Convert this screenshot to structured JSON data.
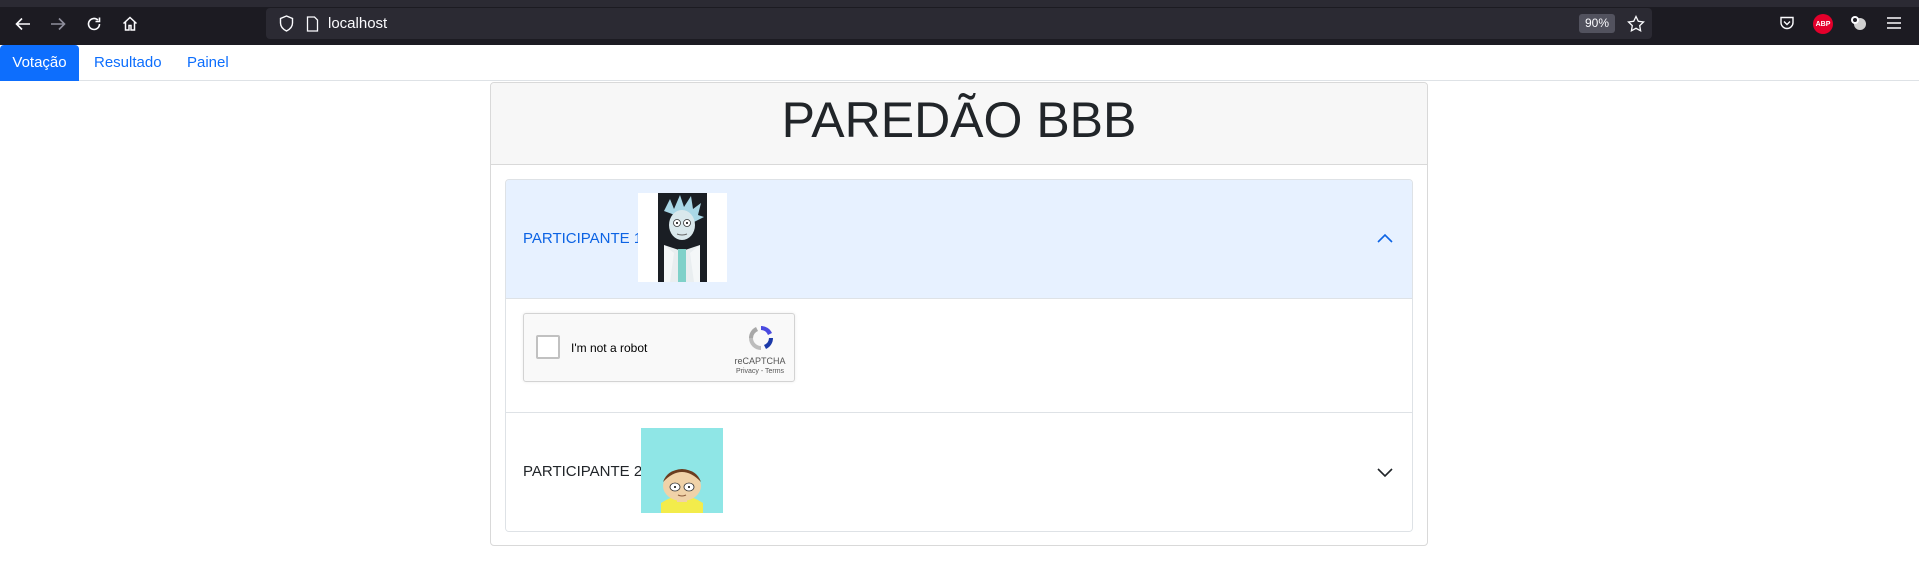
{
  "browser": {
    "url": "localhost",
    "zoom": "90%"
  },
  "nav": {
    "items": [
      {
        "label": "Votação",
        "active": true
      },
      {
        "label": "Resultado",
        "active": false
      },
      {
        "label": "Painel",
        "active": false
      }
    ]
  },
  "page": {
    "title": "PAREDÃO BBB"
  },
  "participants": [
    {
      "label": "PARTICIPANTE 1",
      "expanded": true,
      "avatar": "rick-avatar"
    },
    {
      "label": "PARTICIPANTE 2",
      "expanded": false,
      "avatar": "morty-avatar"
    }
  ],
  "recaptcha": {
    "label": "I'm not a robot",
    "brand": "reCAPTCHA",
    "links": "Privacy - Terms"
  },
  "colors": {
    "accent": "#0d6efd",
    "accordion_active_bg": "#e7f1ff",
    "browser_chrome": "#1c1b22"
  }
}
